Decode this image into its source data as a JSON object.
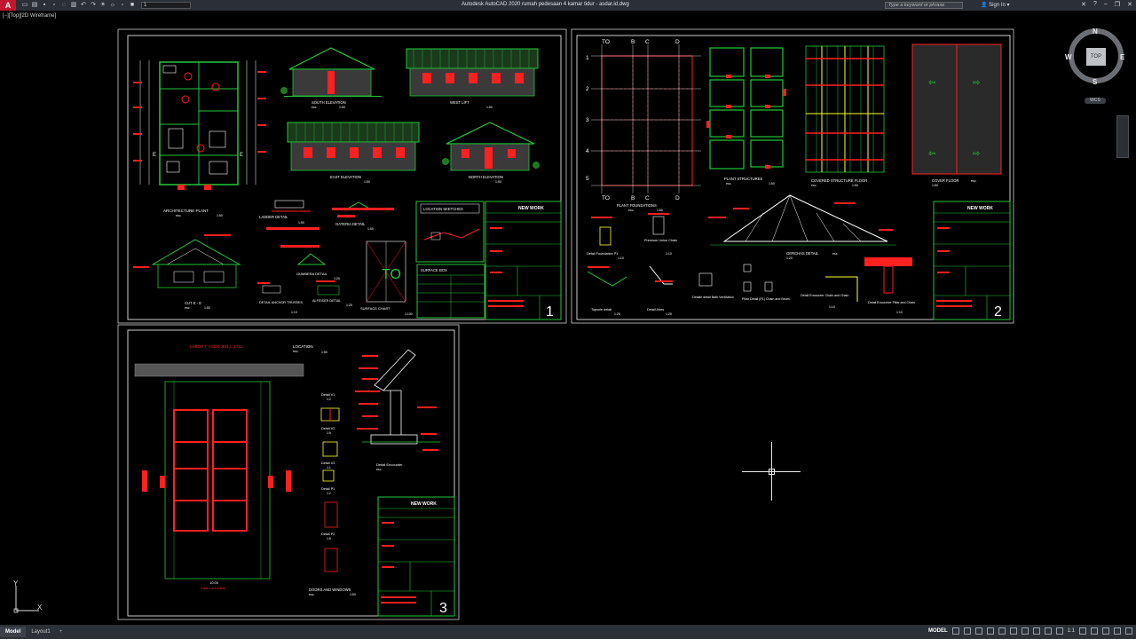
{
  "app": {
    "logo_letter": "A",
    "title": "Autodesk AutoCAD 2020   rumah pedesaan 4 kamar tidur - asdar.id.dwg",
    "layer_value": "1",
    "search_placeholder": "Type a keyword or phrase",
    "signin_label": "Sign In",
    "viewport_label": "[−][Top][2D Wireframe]"
  },
  "viewcube": {
    "face": "TOP",
    "north": "N",
    "south": "S",
    "east": "E",
    "west": "W",
    "wcs": "WCS"
  },
  "sheet1": {
    "elevations": [
      "SOUTH ELEVATION",
      "WEST LIFT",
      "EAST ELEVATION",
      "NORTH ELEVATION"
    ],
    "scale": "1:50",
    "sc": "esc.",
    "architecture_plant": "ARCHITECTURE PLANT",
    "ladder_detail": "LADDER DETAIL",
    "gateria_detail": "GATERIA DETAIL",
    "location_sketches": "LOCATION SKETCHES",
    "cut": "CUT E - E",
    "detail_anchor": "DETAIL ANCHOR TRUSSES",
    "gumbera_detail": "GUMBERA DETAIL",
    "alfeiser_detail": "ALFEISER DETAIL",
    "surface_chart": "SURFACE CHART",
    "to_label": "TO",
    "surface_box": "SURFACE BOX",
    "new_work": "NEW WORK",
    "sheet_no": "1",
    "scale_100": "1:100",
    "scale_10": "1:10",
    "scale_25": "1:25"
  },
  "sheet2": {
    "col_labels": [
      "TO",
      "B",
      "C",
      "D"
    ],
    "row_labels": [
      "1",
      "2",
      "3",
      "4",
      "5"
    ],
    "plant_foundations": "PLANT FOUNDATIONS",
    "plant_structures": "PLANT STRUCTURES",
    "covered_structure_floor": "COVERED STRUCTURE FLOOR",
    "cover_floor": "COVER FLOOR",
    "detail_foundation": "Detail Foundation P1",
    "premium_union_chain": "Premium Union Chain",
    "gerchas_detail": "GERCHAS DETAIL",
    "topsoin_detail": "Topsoin detail",
    "detail_alres": "Detail Alres",
    "detalle_ventilation": "Detalle detail Bath Ventilation",
    "pillar_detail": "Pillar Detail (P1) Chain and Beam",
    "detail_encounter_chain": "Detail Encounter Chain and Chain",
    "detail_encounter_pillar": "Detail Encounter Pillar and Chain",
    "new_work": "NEW WORK",
    "sheet_no": "2",
    "sc": "esc.",
    "scale_50": "1:50",
    "scale_10": "1:10",
    "scale_20": "1:20",
    "scale_25": "1:25"
  },
  "sheet3": {
    "header": "LABOR T: KSEN JEN 2, 1711",
    "location": "LOCATION",
    "sc": "esc.",
    "scale_50": "1:50",
    "scale_2": "1:2",
    "scale_5": "1:5",
    "scale_1": "1:1",
    "details": [
      "Detail V1",
      "Detail V2",
      "Detail V3",
      "Detail P1",
      "Detail P2"
    ],
    "detail_encounter": "Detail Encounter",
    "doors_windows": "DOORS AND WINDOWS",
    "dim_bottom": "10.00",
    "street": "Calle La Calleta",
    "new_work": "NEW WORK",
    "sheet_no": "3"
  },
  "ucs": {
    "x": "X",
    "y": "Y"
  },
  "status": {
    "tabs": [
      "Model",
      "Layout1"
    ],
    "add": "+",
    "model_label": "MODEL",
    "scale": "1:1"
  },
  "colors": {
    "green": "#22c93a",
    "red": "#ff2020",
    "yellow": "#ffff33",
    "cyan": "#00ffff",
    "white": "#ffffff",
    "paper_border": "#cfcfcf"
  }
}
